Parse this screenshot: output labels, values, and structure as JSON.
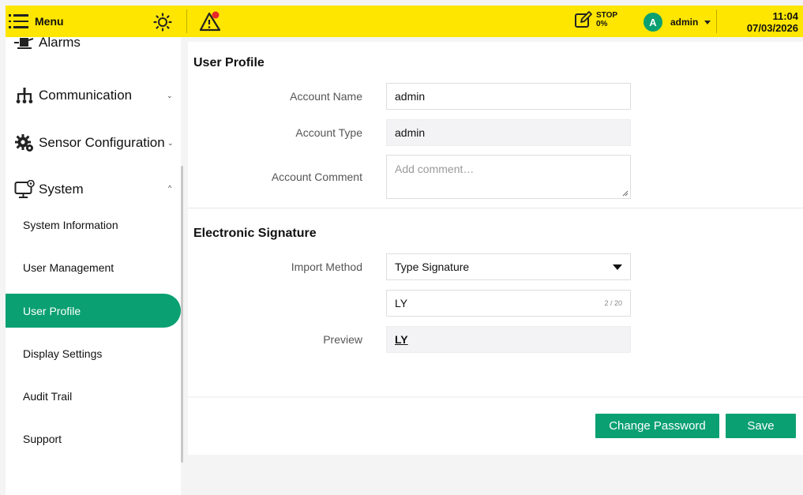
{
  "topbar": {
    "menu_label": "Menu",
    "stop_label": "STOP",
    "stop_percent": "0%",
    "user_initial": "A",
    "user_name": "admin",
    "time": "11:04",
    "date": "07/03/2026"
  },
  "sidebar": {
    "items": [
      {
        "label": "Alarms",
        "icon": "alarm-icon"
      },
      {
        "label": "Communication",
        "icon": "network-icon"
      },
      {
        "label": "Sensor Configuration",
        "icon": "gear-icon"
      },
      {
        "label": "System",
        "icon": "monitor-settings-icon"
      }
    ],
    "sub_items": [
      "System Information",
      "User Management",
      "User Profile",
      "Display Settings",
      "Audit Trail",
      "Support"
    ],
    "active_sub_item": "User Profile"
  },
  "profile": {
    "title": "User Profile",
    "account_name_label": "Account Name",
    "account_name_value": "admin",
    "account_type_label": "Account Type",
    "account_type_value": "admin",
    "account_comment_label": "Account Comment",
    "account_comment_placeholder": "Add comment…"
  },
  "signature": {
    "title": "Electronic Signature",
    "import_method_label": "Import Method",
    "import_method_value": "Type Signature",
    "signature_text": "LY",
    "char_count": "2 / 20",
    "preview_label": "Preview",
    "preview_value": "LY"
  },
  "actions": {
    "change_password": "Change Password",
    "save": "Save"
  },
  "colors": {
    "topbar": "#ffe600",
    "accent": "#0aa071",
    "warning_dot": "#e8272b"
  }
}
